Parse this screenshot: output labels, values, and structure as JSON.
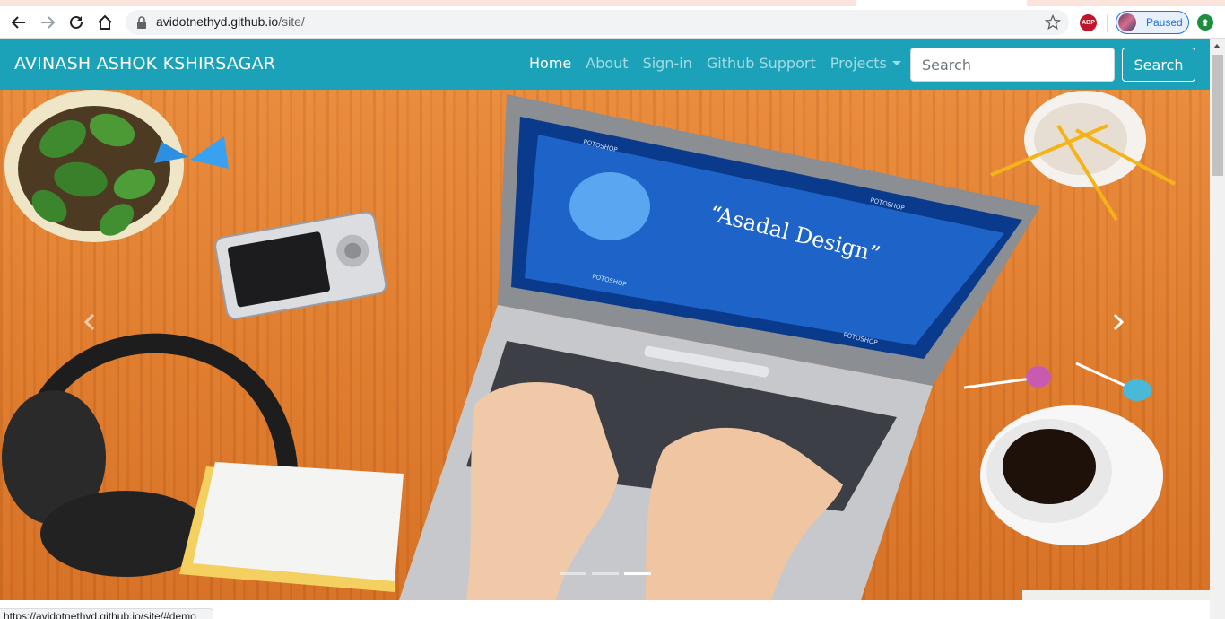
{
  "browser": {
    "url_host": "avidotnethyd.github.io",
    "url_path": "/site/",
    "profile_label": "Paused",
    "extension_abp": "ABP",
    "status_url": "https://avidotnethyd.github.io/site/#demo"
  },
  "navbar": {
    "brand": "AVINASH ASHOK KSHIRSAGAR",
    "links": [
      {
        "label": "Home",
        "active": true
      },
      {
        "label": "About",
        "active": false
      },
      {
        "label": "Sign-in",
        "active": false
      },
      {
        "label": "Github Support",
        "active": false
      },
      {
        "label": "Projects",
        "active": false,
        "dropdown": true
      }
    ],
    "search_placeholder": "Search",
    "search_button": "Search",
    "accent_color": "#1ba2b8"
  },
  "carousel": {
    "slide_text": "“Asadal Design”",
    "screen_labels": [
      "POTOSHOP",
      "POTOSHOP",
      "POTOSHOP",
      "POTOSHOP"
    ],
    "indicators": [
      false,
      false,
      true
    ],
    "prev_icon": "chevron-left-icon",
    "next_icon": "chevron-right-icon"
  }
}
